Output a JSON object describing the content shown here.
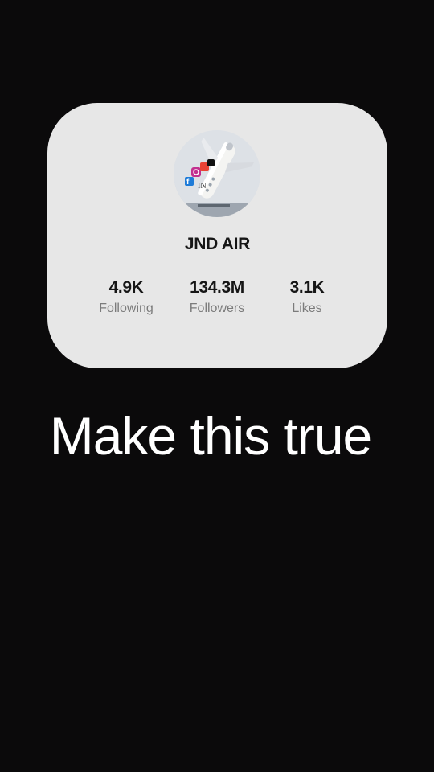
{
  "profile": {
    "name": "JND AIR",
    "avatar_icon": "airplane-social-logo-icon"
  },
  "stats": [
    {
      "value": "4.9K",
      "label": "Following"
    },
    {
      "value": "134.3M",
      "label": "Followers"
    },
    {
      "value": "3.1K",
      "label": "Likes"
    }
  ],
  "caption": "Make this true",
  "colors": {
    "background": "#0b0a0b",
    "card": "#e7e7e7",
    "text_primary": "#161616",
    "text_secondary": "#7b7b7b",
    "caption": "#ffffff"
  }
}
